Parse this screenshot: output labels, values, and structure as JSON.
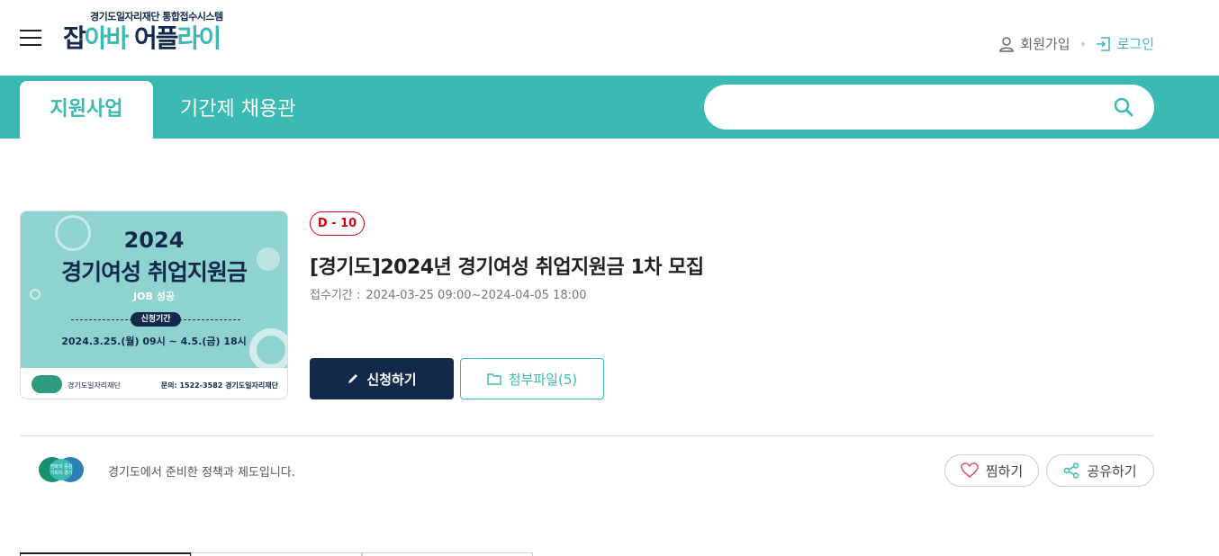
{
  "header": {
    "logo_sub": "경기도일자리재단 통합접수시스템",
    "logo_main_1": "잡",
    "logo_main_2": "아바 ",
    "logo_main_3": "어플",
    "logo_main_4": "라이",
    "join_label": "회원가입",
    "login_label": "로그인"
  },
  "nav": {
    "tabs": [
      {
        "label": "지원사업",
        "active": true
      },
      {
        "label": "기간제 채용관",
        "active": false
      }
    ],
    "search_placeholder": ""
  },
  "poster": {
    "year": "2024",
    "title": "경기여성 취업지원금",
    "subtitle": "JOB 성공",
    "period_label": "신청기간",
    "dates": "2024.3.25.(월) 09시 ~ 4.5.(금) 18시",
    "contact": "문의: 1522-3582 경기도일자리재단",
    "org": "경기도일자리재단"
  },
  "detail": {
    "dday": "D - 10",
    "title": "[경기도]2024년 경기여성 취업지원금 1차 모집",
    "period_label": "접수기간 :",
    "period_value": "2024-03-25 09:00~2024-04-05 18:00",
    "apply_label": "신청하기",
    "file_label": "첨부파일(5)"
  },
  "org_info": {
    "logo_text": "변화의 중심 기회의 경기",
    "description": "경기도에서 준비한 정책과 제도입니다.",
    "like_label": "찜하기",
    "share_label": "공유하기"
  },
  "colors": {
    "teal": "#3bbab3",
    "navy": "#13294b",
    "dday_red": "#d0021b"
  }
}
